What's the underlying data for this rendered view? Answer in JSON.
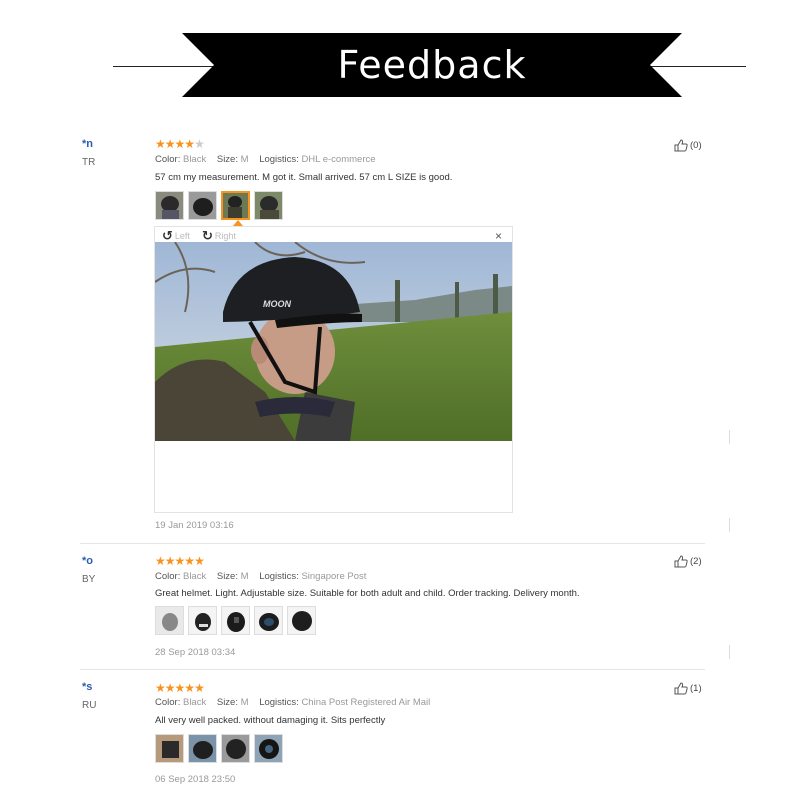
{
  "banner": {
    "title": "Feedback"
  },
  "viewer": {
    "left_label": "Left",
    "right_label": "Right",
    "close": "×"
  },
  "reviews": [
    {
      "user": "*n",
      "country": "TR",
      "rating": 4,
      "color_key": "Color:",
      "color_val": "Black",
      "size_key": "Size:",
      "size_val": "M",
      "logistics_key": "Logistics:",
      "logistics_val": "DHL e-commerce",
      "text": "57 cm my measurement. M got it. Small arrived. 57 cm L SIZE is good.",
      "date": "19 Jan 2019 03:16",
      "helpful": "(0)"
    },
    {
      "user": "*o",
      "country": "BY",
      "rating": 5,
      "color_key": "Color:",
      "color_val": "Black",
      "size_key": "Size:",
      "size_val": "M",
      "logistics_key": "Logistics:",
      "logistics_val": "Singapore Post",
      "text": "Great helmet. Light. Adjustable size. Suitable for both adult and child. Order tracking. Delivery month.",
      "date": "28 Sep 2018 03:34",
      "helpful": "(2)"
    },
    {
      "user": "*s",
      "country": "RU",
      "rating": 5,
      "color_key": "Color:",
      "color_val": "Black",
      "size_key": "Size:",
      "size_val": "M",
      "logistics_key": "Logistics:",
      "logistics_val": "China Post Registered Air Mail",
      "text": "All very well packed. without damaging it. Sits perfectly",
      "date": "06 Sep 2018 23:50",
      "helpful": "(1)"
    }
  ],
  "colors": {
    "star": "#f7931e",
    "user": "#2a5db0",
    "banner": "#000000"
  },
  "photo_text": "MOON"
}
